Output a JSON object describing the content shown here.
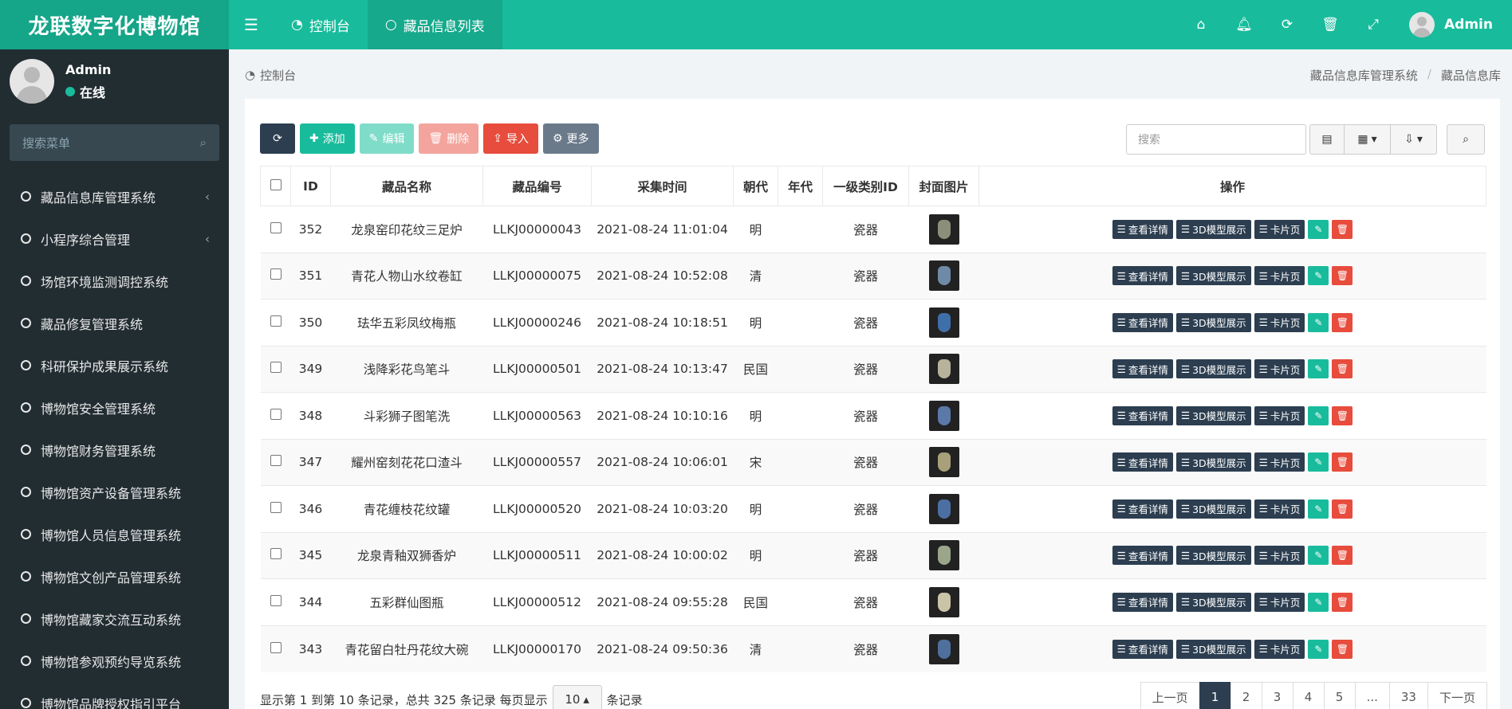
{
  "brand": "龙联数字化博物馆",
  "header": {
    "tabs": [
      {
        "label": "控制台",
        "icon": "dashboard-icon",
        "active": false
      },
      {
        "label": "藏品信息列表",
        "icon": "circle-icon",
        "active": true
      }
    ],
    "icons": [
      "home-icon",
      "bell-icon",
      "refresh-icon",
      "trash-icon",
      "fullscreen-icon"
    ],
    "user": "Admin"
  },
  "sidebar": {
    "user_name": "Admin",
    "status": "在线",
    "search_placeholder": "搜索菜单",
    "items": [
      {
        "label": "藏品信息库管理系统",
        "has_caret": true
      },
      {
        "label": "小程序综合管理",
        "has_caret": true
      },
      {
        "label": "场馆环境监测调控系统",
        "has_caret": false
      },
      {
        "label": "藏品修复管理系统",
        "has_caret": false
      },
      {
        "label": "科研保护成果展示系统",
        "has_caret": false
      },
      {
        "label": "博物馆安全管理系统",
        "has_caret": false
      },
      {
        "label": "博物馆财务管理系统",
        "has_caret": false
      },
      {
        "label": "博物馆资产设备管理系统",
        "has_caret": false
      },
      {
        "label": "博物馆人员信息管理系统",
        "has_caret": false
      },
      {
        "label": "博物馆文创产品管理系统",
        "has_caret": false
      },
      {
        "label": "博物馆藏家交流互动系统",
        "has_caret": false
      },
      {
        "label": "博物馆参观预约导览系统",
        "has_caret": false
      },
      {
        "label": "博物馆品牌授权指引平台",
        "has_caret": false
      }
    ]
  },
  "breadcrumb": {
    "left": "控制台",
    "right": [
      "藏品信息库管理系统",
      "藏品信息库"
    ],
    "sep": "/"
  },
  "toolbar": {
    "add": "添加",
    "edit": "编辑",
    "delete": "删除",
    "import": "导入",
    "more": "更多",
    "search_placeholder": "搜索"
  },
  "table": {
    "headers": [
      "ID",
      "藏品名称",
      "藏品编号",
      "采集时间",
      "朝代",
      "年代",
      "一级类别ID",
      "封面图片",
      "操作"
    ],
    "op_labels": {
      "detail": "查看详情",
      "model": "3D模型展示",
      "card": "卡片页"
    },
    "rows": [
      {
        "id": "352",
        "name": "龙泉窑印花纹三足炉",
        "code": "LLKJ00000043",
        "time": "2021-08-24 11:01:04",
        "dynasty": "明",
        "era": "",
        "category": "瓷器",
        "thumb_color": "#8a8f7a"
      },
      {
        "id": "351",
        "name": "青花人物山水纹卷缸",
        "code": "LLKJ00000075",
        "time": "2021-08-24 10:52:08",
        "dynasty": "清",
        "era": "",
        "category": "瓷器",
        "thumb_color": "#6f8aa6"
      },
      {
        "id": "350",
        "name": "珐华五彩凤纹梅瓶",
        "code": "LLKJ00000246",
        "time": "2021-08-24 10:18:51",
        "dynasty": "明",
        "era": "",
        "category": "瓷器",
        "thumb_color": "#3f6fa8"
      },
      {
        "id": "349",
        "name": "浅降彩花鸟笔斗",
        "code": "LLKJ00000501",
        "time": "2021-08-24 10:13:47",
        "dynasty": "民国",
        "era": "",
        "category": "瓷器",
        "thumb_color": "#b8b19b"
      },
      {
        "id": "348",
        "name": "斗彩狮子图笔洗",
        "code": "LLKJ00000563",
        "time": "2021-08-24 10:10:16",
        "dynasty": "明",
        "era": "",
        "category": "瓷器",
        "thumb_color": "#5b79a8"
      },
      {
        "id": "347",
        "name": "耀州窑刻花花口渣斗",
        "code": "LLKJ00000557",
        "time": "2021-08-24 10:06:01",
        "dynasty": "宋",
        "era": "",
        "category": "瓷器",
        "thumb_color": "#a8a07a"
      },
      {
        "id": "346",
        "name": "青花缠枝花纹罐",
        "code": "LLKJ00000520",
        "time": "2021-08-24 10:03:20",
        "dynasty": "明",
        "era": "",
        "category": "瓷器",
        "thumb_color": "#4b6fa3"
      },
      {
        "id": "345",
        "name": "龙泉青釉双狮香炉",
        "code": "LLKJ00000511",
        "time": "2021-08-24 10:00:02",
        "dynasty": "明",
        "era": "",
        "category": "瓷器",
        "thumb_color": "#9aa58a"
      },
      {
        "id": "344",
        "name": "五彩群仙图瓶",
        "code": "LLKJ00000512",
        "time": "2021-08-24 09:55:28",
        "dynasty": "民国",
        "era": "",
        "category": "瓷器",
        "thumb_color": "#c9c3a8"
      },
      {
        "id": "343",
        "name": "青花留白牡丹花纹大碗",
        "code": "LLKJ00000170",
        "time": "2021-08-24 09:50:36",
        "dynasty": "清",
        "era": "",
        "category": "瓷器",
        "thumb_color": "#4f6f9c"
      }
    ]
  },
  "footer": {
    "summary": "显示第 1 到第 10 条记录，总共 325 条记录 每页显示",
    "page_size": "10",
    "suffix": "条记录",
    "pages": [
      "上一页",
      "1",
      "2",
      "3",
      "4",
      "5",
      "...",
      "33",
      "下一页"
    ],
    "active_page": "1"
  }
}
